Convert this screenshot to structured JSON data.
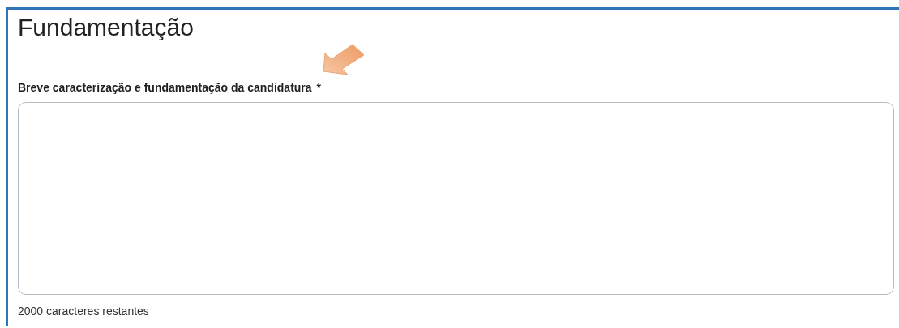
{
  "section": {
    "title": "Fundamentação"
  },
  "field": {
    "label": "Breve caracterização e fundamentação da candidatura",
    "required_mark": "*",
    "counter": "2000 caracteres restantes"
  }
}
